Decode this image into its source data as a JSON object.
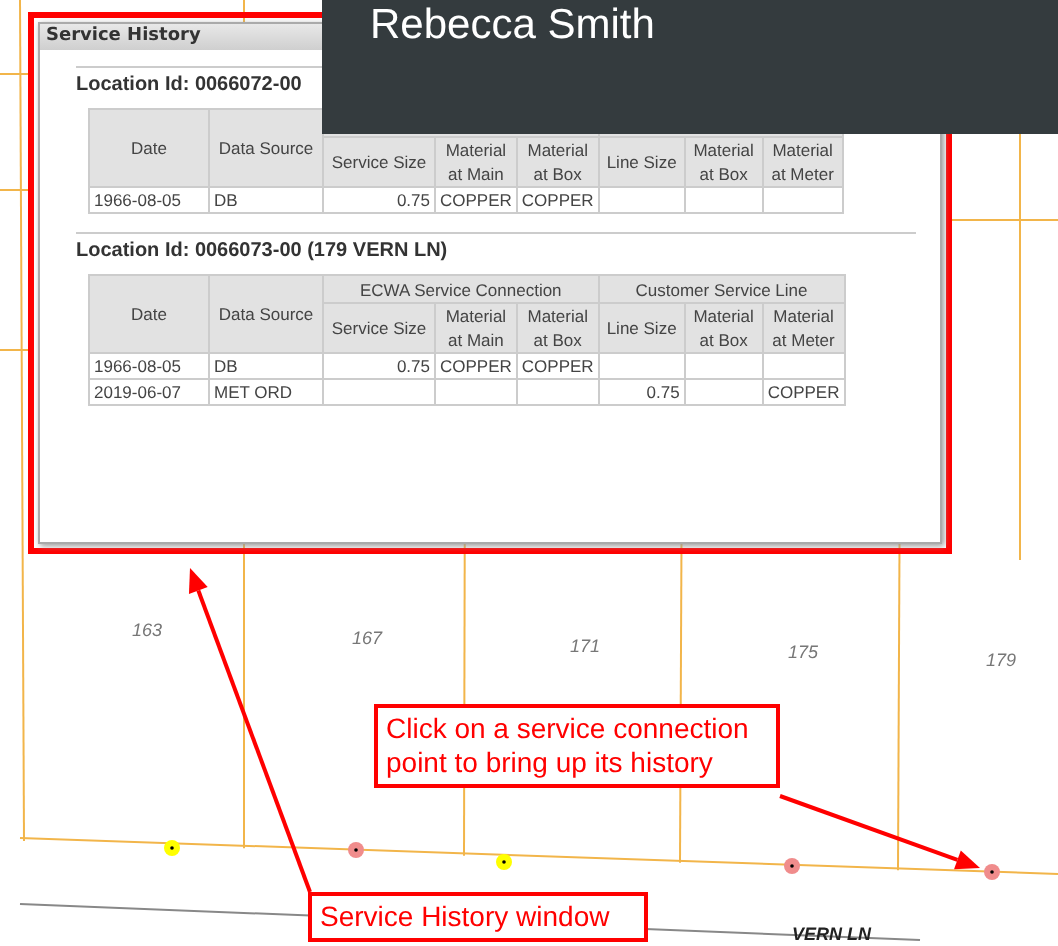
{
  "overlay_banner": {
    "name": "Rebecca Smith"
  },
  "window": {
    "title": "Service History",
    "highlighted": true,
    "locations": [
      {
        "label": "Location Id: 0066072-00",
        "table": {
          "columns": [
            {
              "label": "Date"
            },
            {
              "label": "Data Source"
            }
          ],
          "groups": [
            {
              "columns": [
                {
                  "label": "Service Size"
                },
                {
                  "label": "Material at Main"
                },
                {
                  "label": "Material at Box"
                }
              ]
            },
            {
              "columns": [
                {
                  "label": "Line Size"
                },
                {
                  "label": "Material at Box"
                },
                {
                  "label": "Material at Meter"
                }
              ]
            }
          ],
          "rows": [
            [
              "1966-08-05",
              "DB",
              "0.75",
              "COPPER",
              "COPPER",
              null,
              null,
              null
            ]
          ]
        }
      },
      {
        "label": "Location Id: 0066073-00 (179 VERN LN)",
        "table": {
          "columns": [
            {
              "label": "Date"
            },
            {
              "label": "Data Source"
            }
          ],
          "groups": [
            {
              "label": "ECWA Service Connection",
              "columns": [
                {
                  "label": "Service Size"
                },
                {
                  "label": "Material at Main"
                },
                {
                  "label": "Material at Box"
                }
              ]
            },
            {
              "label": "Customer Service Line",
              "columns": [
                {
                  "label": "Line Size"
                },
                {
                  "label": "Material at Box"
                },
                {
                  "label": "Material at Meter"
                }
              ]
            }
          ],
          "rows": [
            [
              "1966-08-05",
              "DB",
              "0.75",
              "COPPER",
              "COPPER",
              null,
              null,
              null
            ],
            [
              "2019-06-07",
              "MET ORD",
              null,
              null,
              null,
              "0.75",
              null,
              "COPPER"
            ]
          ]
        }
      }
    ]
  },
  "map": {
    "lots": [
      "163",
      "167",
      "171",
      "175",
      "179"
    ],
    "service_points": [
      {
        "color": "#ffff00"
      },
      {
        "color": "#f08c8c"
      },
      {
        "color": "#ffff00"
      },
      {
        "color": "#f08c8c"
      },
      {
        "color": "#f08c8c"
      }
    ],
    "street_label": "VERN LN"
  },
  "annotations": [
    {
      "text": "Click on a service connection point to bring up its history"
    },
    {
      "text": "Service History window"
    }
  ]
}
